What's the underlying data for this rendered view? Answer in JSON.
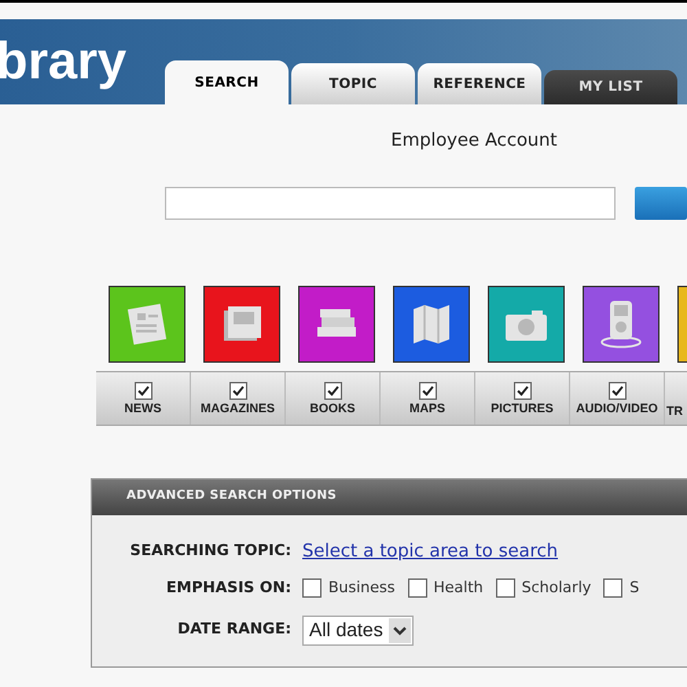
{
  "logo": "brary",
  "tabs": [
    {
      "label": "SEARCH",
      "selected": true,
      "kind": "standard"
    },
    {
      "label": "TOPIC",
      "selected": false,
      "kind": "standard"
    },
    {
      "label": "REFERENCE",
      "selected": false,
      "kind": "standard"
    },
    {
      "label": "MY LIST",
      "selected": false,
      "kind": "personal"
    }
  ],
  "account": "Employee Account",
  "categories": [
    {
      "label": "NEWS",
      "checked": true,
      "color": "#5cc41c",
      "kind": "news"
    },
    {
      "label": "MAGAZINES",
      "checked": true,
      "color": "#e8141c",
      "kind": "magazines"
    },
    {
      "label": "BOOKS",
      "checked": true,
      "color": "#c21cc8",
      "kind": "books"
    },
    {
      "label": "MAPS",
      "checked": true,
      "color": "#1c5ce0",
      "kind": "maps"
    },
    {
      "label": "PICTURES",
      "checked": true,
      "color": "#14aaa8",
      "kind": "pictures"
    },
    {
      "label": "AUDIO/VIDEO",
      "checked": true,
      "color": "#9450e0",
      "kind": "audio"
    },
    {
      "label": "TR",
      "color": "#e8b81c",
      "kind": "other"
    }
  ],
  "advanced": {
    "title": "ADVANCED SEARCH OPTIONS",
    "topic_label": "SEARCHING TOPIC:",
    "topic_link": "Select a topic area to search",
    "emphasis_label": "EMPHASIS ON:",
    "emphasis": [
      {
        "label": "Business",
        "checked": false
      },
      {
        "label": "Health",
        "checked": false
      },
      {
        "label": "Scholarly",
        "checked": false
      },
      {
        "label": "S",
        "checked": false
      }
    ],
    "date_label": "DATE RANGE:",
    "date_value": "All dates"
  }
}
